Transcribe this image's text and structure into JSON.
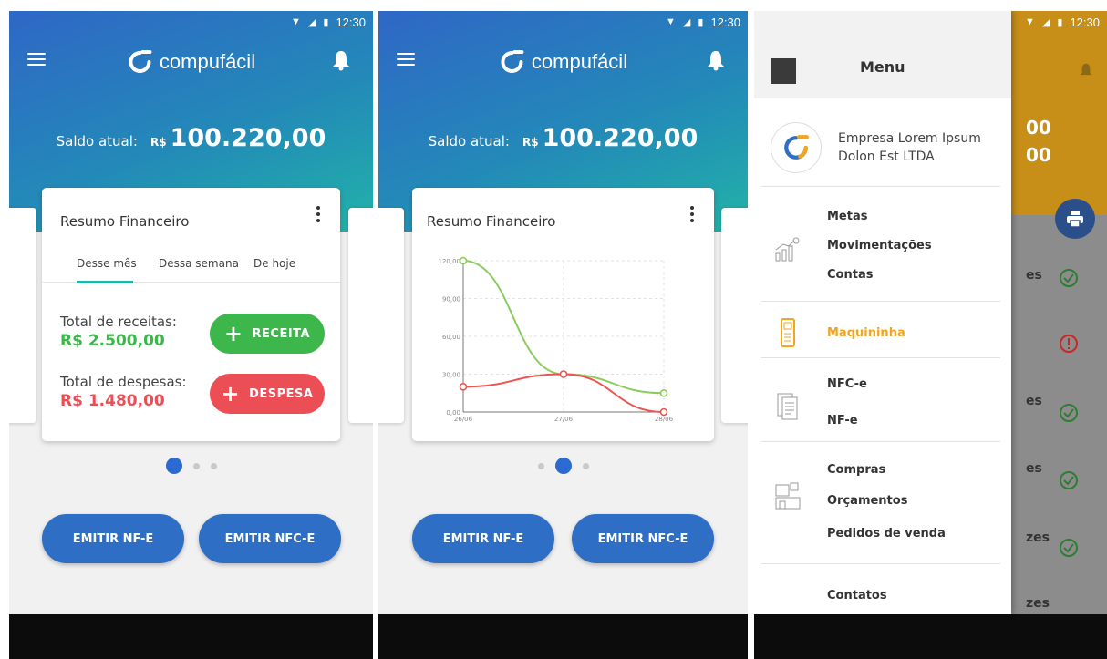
{
  "status": {
    "time": "12:30"
  },
  "brand": {
    "name": "compufácil"
  },
  "balance": {
    "label": "Saldo atual:",
    "currency": "R$",
    "value": "100.220,00"
  },
  "card": {
    "title": "Resumo Financeiro",
    "tabs": [
      "Desse mês",
      "Dessa semana",
      "De hoje"
    ],
    "revenue_label": "Total de receitas:",
    "revenue_value": "R$ 2.500,00",
    "expense_label": "Total de despesas:",
    "expense_value": "R$ 1.480,00",
    "revenue_button": "RECEITA",
    "expense_button": "DESPESA"
  },
  "actions": {
    "emit_nfe": "EMITIR NF-E",
    "emit_nfce": "EMITIR NFC-E"
  },
  "colors": {
    "primary": "#2e6ec4",
    "green": "#3db64b",
    "red": "#ec4e56",
    "teal": "#22b4a8",
    "orange": "#f2a51e"
  },
  "chart_data": {
    "type": "line",
    "x": [
      "26/06",
      "27/06",
      "28/06"
    ],
    "y_ticks": [
      "0,00",
      "30,00",
      "60,00",
      "90,00",
      "120,00"
    ],
    "ylim": [
      0,
      120
    ],
    "series": [
      {
        "color": "#8ccc5f",
        "values": [
          120,
          30,
          15
        ]
      },
      {
        "color": "#ef5350",
        "values": [
          20,
          30,
          0
        ]
      }
    ],
    "grid": true
  },
  "drawer": {
    "title": "Menu",
    "company": "Empresa Lorem Ipsum Dolon Est LTDA",
    "items": {
      "metas": "Metas",
      "movimentacoes": "Movimentações",
      "contas": "Contas",
      "maquininha": "Maquininha",
      "nfce": "NFC-e",
      "nfe": "NF-e",
      "compras": "Compras",
      "orcamentos": "Orçamentos",
      "pedidos": "Pedidos de venda",
      "contatos": "Contatos"
    }
  },
  "background_list": {
    "balance_fragment_1": "00",
    "balance_fragment_2": "00",
    "row_1": "es",
    "row_2": "es",
    "row_3": "es",
    "row_4": "zes",
    "row_5": "zes"
  }
}
